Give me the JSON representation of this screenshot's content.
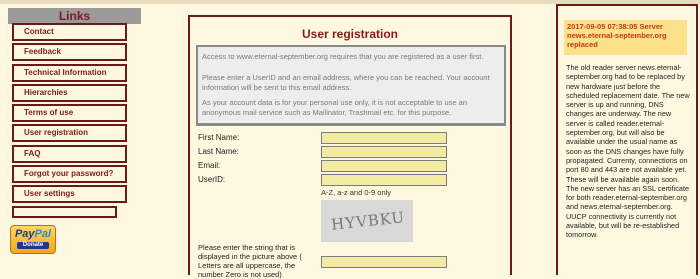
{
  "nav": {
    "heading": "Links",
    "items": [
      {
        "label": "Contact"
      },
      {
        "label": "Feedback"
      },
      {
        "label": "Technical Information"
      },
      {
        "label": "Hierarchies"
      },
      {
        "label": "Terms of use"
      },
      {
        "label": "User registration"
      },
      {
        "label": "FAQ"
      },
      {
        "label": "Forgot your password?"
      },
      {
        "label": "User settings"
      }
    ],
    "donate": {
      "brand_pay": "Pay",
      "brand_pal": "Pal",
      "label": "Donate"
    }
  },
  "registration": {
    "title": "User registration",
    "notice": [
      "Access to www.eternal-september.org requires that you are registered as a user first.",
      "Please enter a UserID and an email address, where you can be reached. Your account information will be sent to this email address.",
      "As your account data is for your personal use only, it is not acceptable to use an anonymous mail service such as Mailinator, Trashmail etc. for this purpose."
    ],
    "fields": {
      "first_name": {
        "label": "First Name:",
        "value": ""
      },
      "last_name": {
        "label": "Last Name:",
        "value": ""
      },
      "email": {
        "label": "Email:",
        "value": ""
      },
      "userid": {
        "label": "UserID:",
        "value": ""
      }
    },
    "userid_hint": "A-Z, a-z and 0-9 only",
    "captcha_text": "HYVBKU",
    "captcha_label": "Please enter the string that is displayed in the picture above ( Letters are all uppercase, the number Zero is not used)",
    "captcha_value": ""
  },
  "news": {
    "heading": "2017-09-05 07:38:05 Server news.eternal-september.org replaced",
    "body": "The old reader server news.eternal-september.org had to be replaced by new hardware just before the scheduled replacement date. The new server is up and running, DNS changes are underway. The new server is called reader.eternal-september.org, but will also be available under the usual name as soon as the DNS changes have fully propagated. Currenty, connections on port 80 and 443 are not available yet. These will be available again soon. The new server has an SSL certificate for both reader.eternal-september.org and news.eternal-september.org. UUCP connectivity is currently not available, but will be re-established tomorrow."
  }
}
